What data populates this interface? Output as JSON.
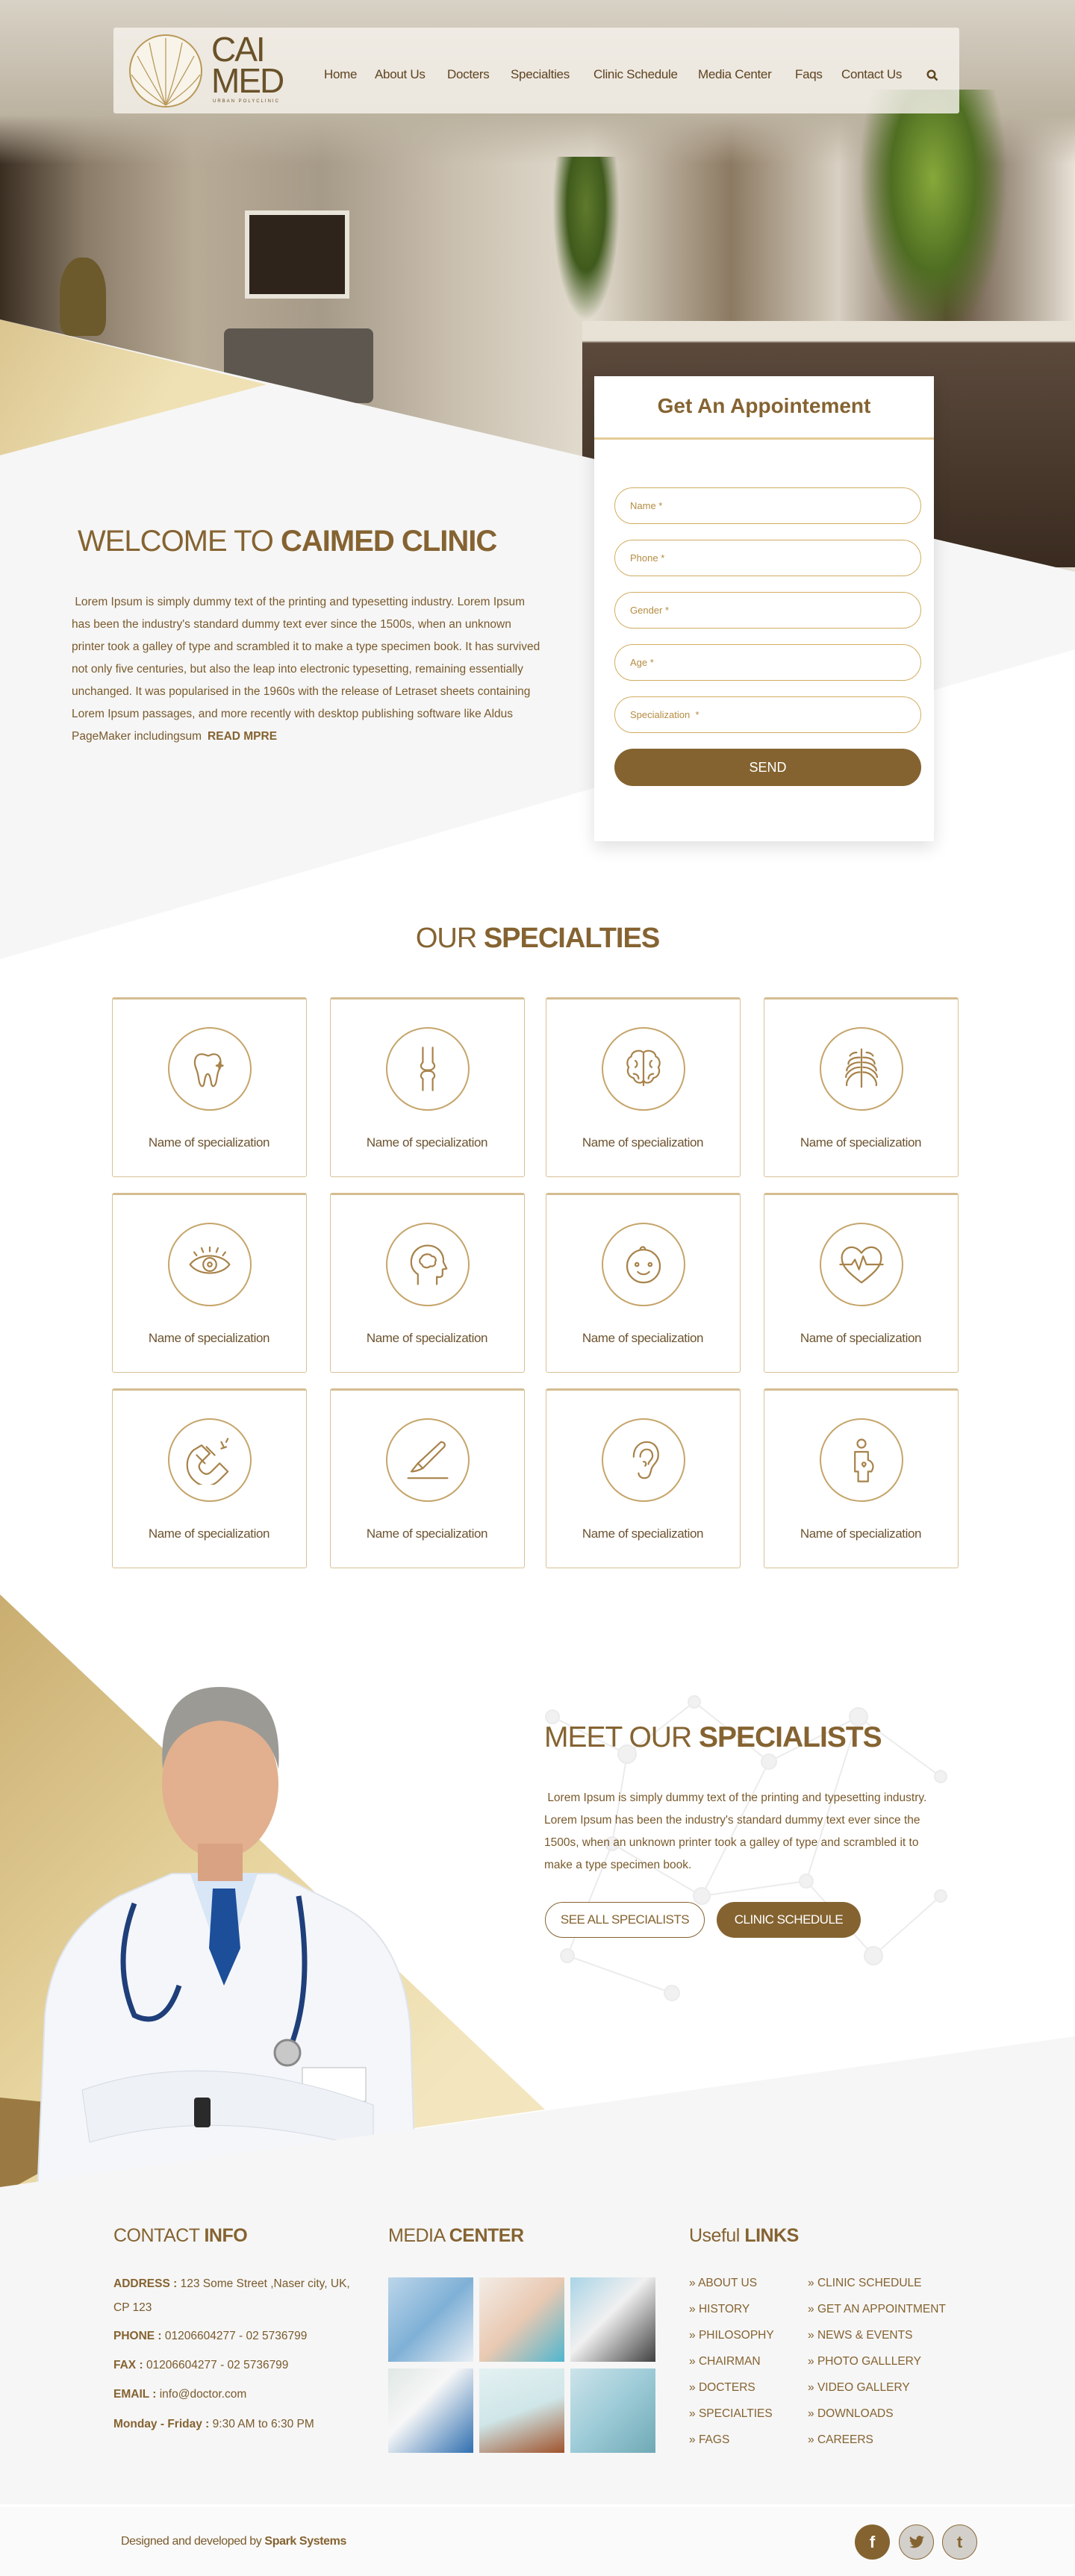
{
  "nav": {
    "logo": {
      "line1": "CAI",
      "line2": "MED",
      "tagline": "URBAN POLYCLINIC"
    },
    "items": [
      "Home",
      "About Us",
      "Docters",
      "Specialties",
      "Clinic Schedule",
      "Media Center",
      "Faqs",
      "Contact Us"
    ],
    "search_icon": "search-icon"
  },
  "welcome": {
    "title_light": "WELCOME TO ",
    "title_bold": "CAIMED CLINIC",
    "body": "Lorem Ipsum is simply dummy text of the printing and typesetting industry. Lorem Ipsum has been the industry's standard dummy text ever since the 1500s, when an unknown printer took a galley of type and scrambled it to make a type specimen book. It has survived not only five centuries, but also the leap into electronic typesetting, remaining essentially unchanged. It was popularised in the 1960s with the release of Letraset sheets containing Lorem Ipsum passages, and more recently with desktop publishing software like Aldus PageMaker includingsum",
    "read_more": "READ MPRE"
  },
  "appointment": {
    "title": "Get An  Appointement",
    "fields": [
      "Name *",
      "Phone *",
      "Gender *",
      "Age *",
      "Specialization  *"
    ],
    "send": "SEND"
  },
  "specialties": {
    "title_light": "OUR ",
    "title_bold": "SPECIALTIES",
    "items": [
      {
        "label": "Name of specialization",
        "icon": "tooth"
      },
      {
        "label": "Name of specialization",
        "icon": "joint"
      },
      {
        "label": "Name of specialization",
        "icon": "brain"
      },
      {
        "label": "Name of specialization",
        "icon": "ribcage"
      },
      {
        "label": "Name of specialization",
        "icon": "eye"
      },
      {
        "label": "Name of specialization",
        "icon": "head-brain"
      },
      {
        "label": "Name of specialization",
        "icon": "baby-face"
      },
      {
        "label": "Name of specialization",
        "icon": "heart-pulse"
      },
      {
        "label": "Name of specialization",
        "icon": "magnet"
      },
      {
        "label": "Name of specialization",
        "icon": "scalpel"
      },
      {
        "label": "Name of specialization",
        "icon": "ear"
      },
      {
        "label": "Name of specialization",
        "icon": "pregnancy"
      }
    ]
  },
  "specialists": {
    "title_light": "MEET OUR ",
    "title_bold": "SPECIALISTS",
    "body": "Lorem Ipsum is simply dummy text of the printing and typesetting industry. Lorem Ipsum has been the industry's standard dummy text ever since the 1500s, when an unknown printer took a galley of type and scrambled it to make a type specimen book.",
    "see_all": "SEE ALL SPECIALISTS",
    "schedule": "CLINIC SCHEDULE"
  },
  "footer": {
    "contact": {
      "heading_light": "CONTACT ",
      "heading_bold": "INFO",
      "rows": [
        {
          "label": "ADDRESS :",
          "value": "123 Some Street ,Naser city, UK, CP 123"
        },
        {
          "label": "PHONE :",
          "value": "01206604277 - 02 5736799"
        },
        {
          "label": "FAX :",
          "value": "01206604277 - 02 5736799"
        },
        {
          "label": "EMAIL :",
          "value": "info@doctor.com"
        },
        {
          "label": "Monday - Friday :",
          "value": "9:30 AM to 6:30 PM"
        }
      ]
    },
    "media": {
      "heading_light": "MEDIA ",
      "heading_bold": "CENTER",
      "images": [
        "gloved-hands",
        "nurse-with-baby",
        "microscope-researcher",
        "doctor-at-desk",
        "patient-woman",
        "surgery-team"
      ]
    },
    "links": {
      "heading_light": "Useful ",
      "heading_bold": "LINKS",
      "col1": [
        "ABOUT US",
        "HISTORY",
        "PHILOSOPHY",
        "CHAIRMAN",
        "DOCTERS",
        "SPECIALTIES",
        "FAGS"
      ],
      "col2": [
        "CLINIC SCHEDULE",
        "GET AN APPOINTMENT",
        "NEWS & EVENTS",
        "PHOTO GALLLERY",
        "VIDEO GALLERY",
        "DOWNLOADS",
        "CAREERS"
      ]
    },
    "bottom": {
      "credit": "Designed and developed by ",
      "brand": "Spark Systems",
      "social": [
        {
          "name": "facebook",
          "glyph": "f"
        },
        {
          "name": "twitter",
          "glyph": "t"
        },
        {
          "name": "tumblr",
          "glyph": "t"
        }
      ]
    }
  },
  "colors": {
    "brand": "#856331",
    "gold": "#e3cc95",
    "background": "#f6f6f6"
  }
}
